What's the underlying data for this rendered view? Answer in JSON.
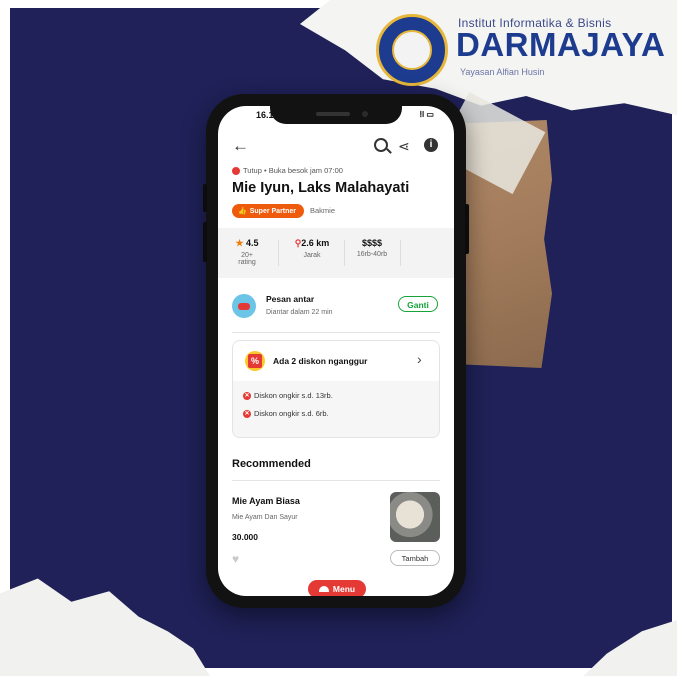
{
  "brand": {
    "institute": "Institut Informatika & Bisnis",
    "name": "DARMAJAYA",
    "foundation": "Yayasan Alfian Husin",
    "colors": {
      "navy": "#1f2158",
      "blue": "#1d3c8f",
      "gold": "#e7b73a"
    }
  },
  "status_bar": {
    "time": "16.1",
    "icons": "ⵑl ▭"
  },
  "header": {
    "back_icon": "←",
    "share_icon": "⋖",
    "info_icon": "i"
  },
  "restaurant": {
    "status": "Tutup • Buka besok jam 07:00",
    "name": "Mie Iyun, Laks Malahayati",
    "badge": "Super Partner",
    "cuisine": "Bakmie"
  },
  "stats": [
    {
      "value": "4.5",
      "label": "20+ rating",
      "icon": "star-icon"
    },
    {
      "value": "2.6 km",
      "label": "Jarak",
      "icon": "pin-icon"
    },
    {
      "value": "$$$$",
      "label": "16rb-40rb"
    }
  ],
  "delivery": {
    "title": "Pesan antar",
    "subtitle": "Diantar dalam 22 min",
    "change_label": "Ganti"
  },
  "promo": {
    "title": "Ada 2 diskon nganggur",
    "items": [
      "Diskon ongkir s.d. 13rb.",
      "Diskon ongkir s.d. 6rb."
    ]
  },
  "recommended": {
    "title": "Recommended",
    "item": {
      "name": "Mie Ayam Biasa",
      "description": "Mie Ayam Dan Sayur",
      "price": "30.000",
      "add_label": "Tambah"
    }
  },
  "bottom": {
    "menu_label": "Menu"
  },
  "theme": {
    "accent_red": "#e53935",
    "partner_orange": "#ef5b0c",
    "green": "#15a33a"
  }
}
